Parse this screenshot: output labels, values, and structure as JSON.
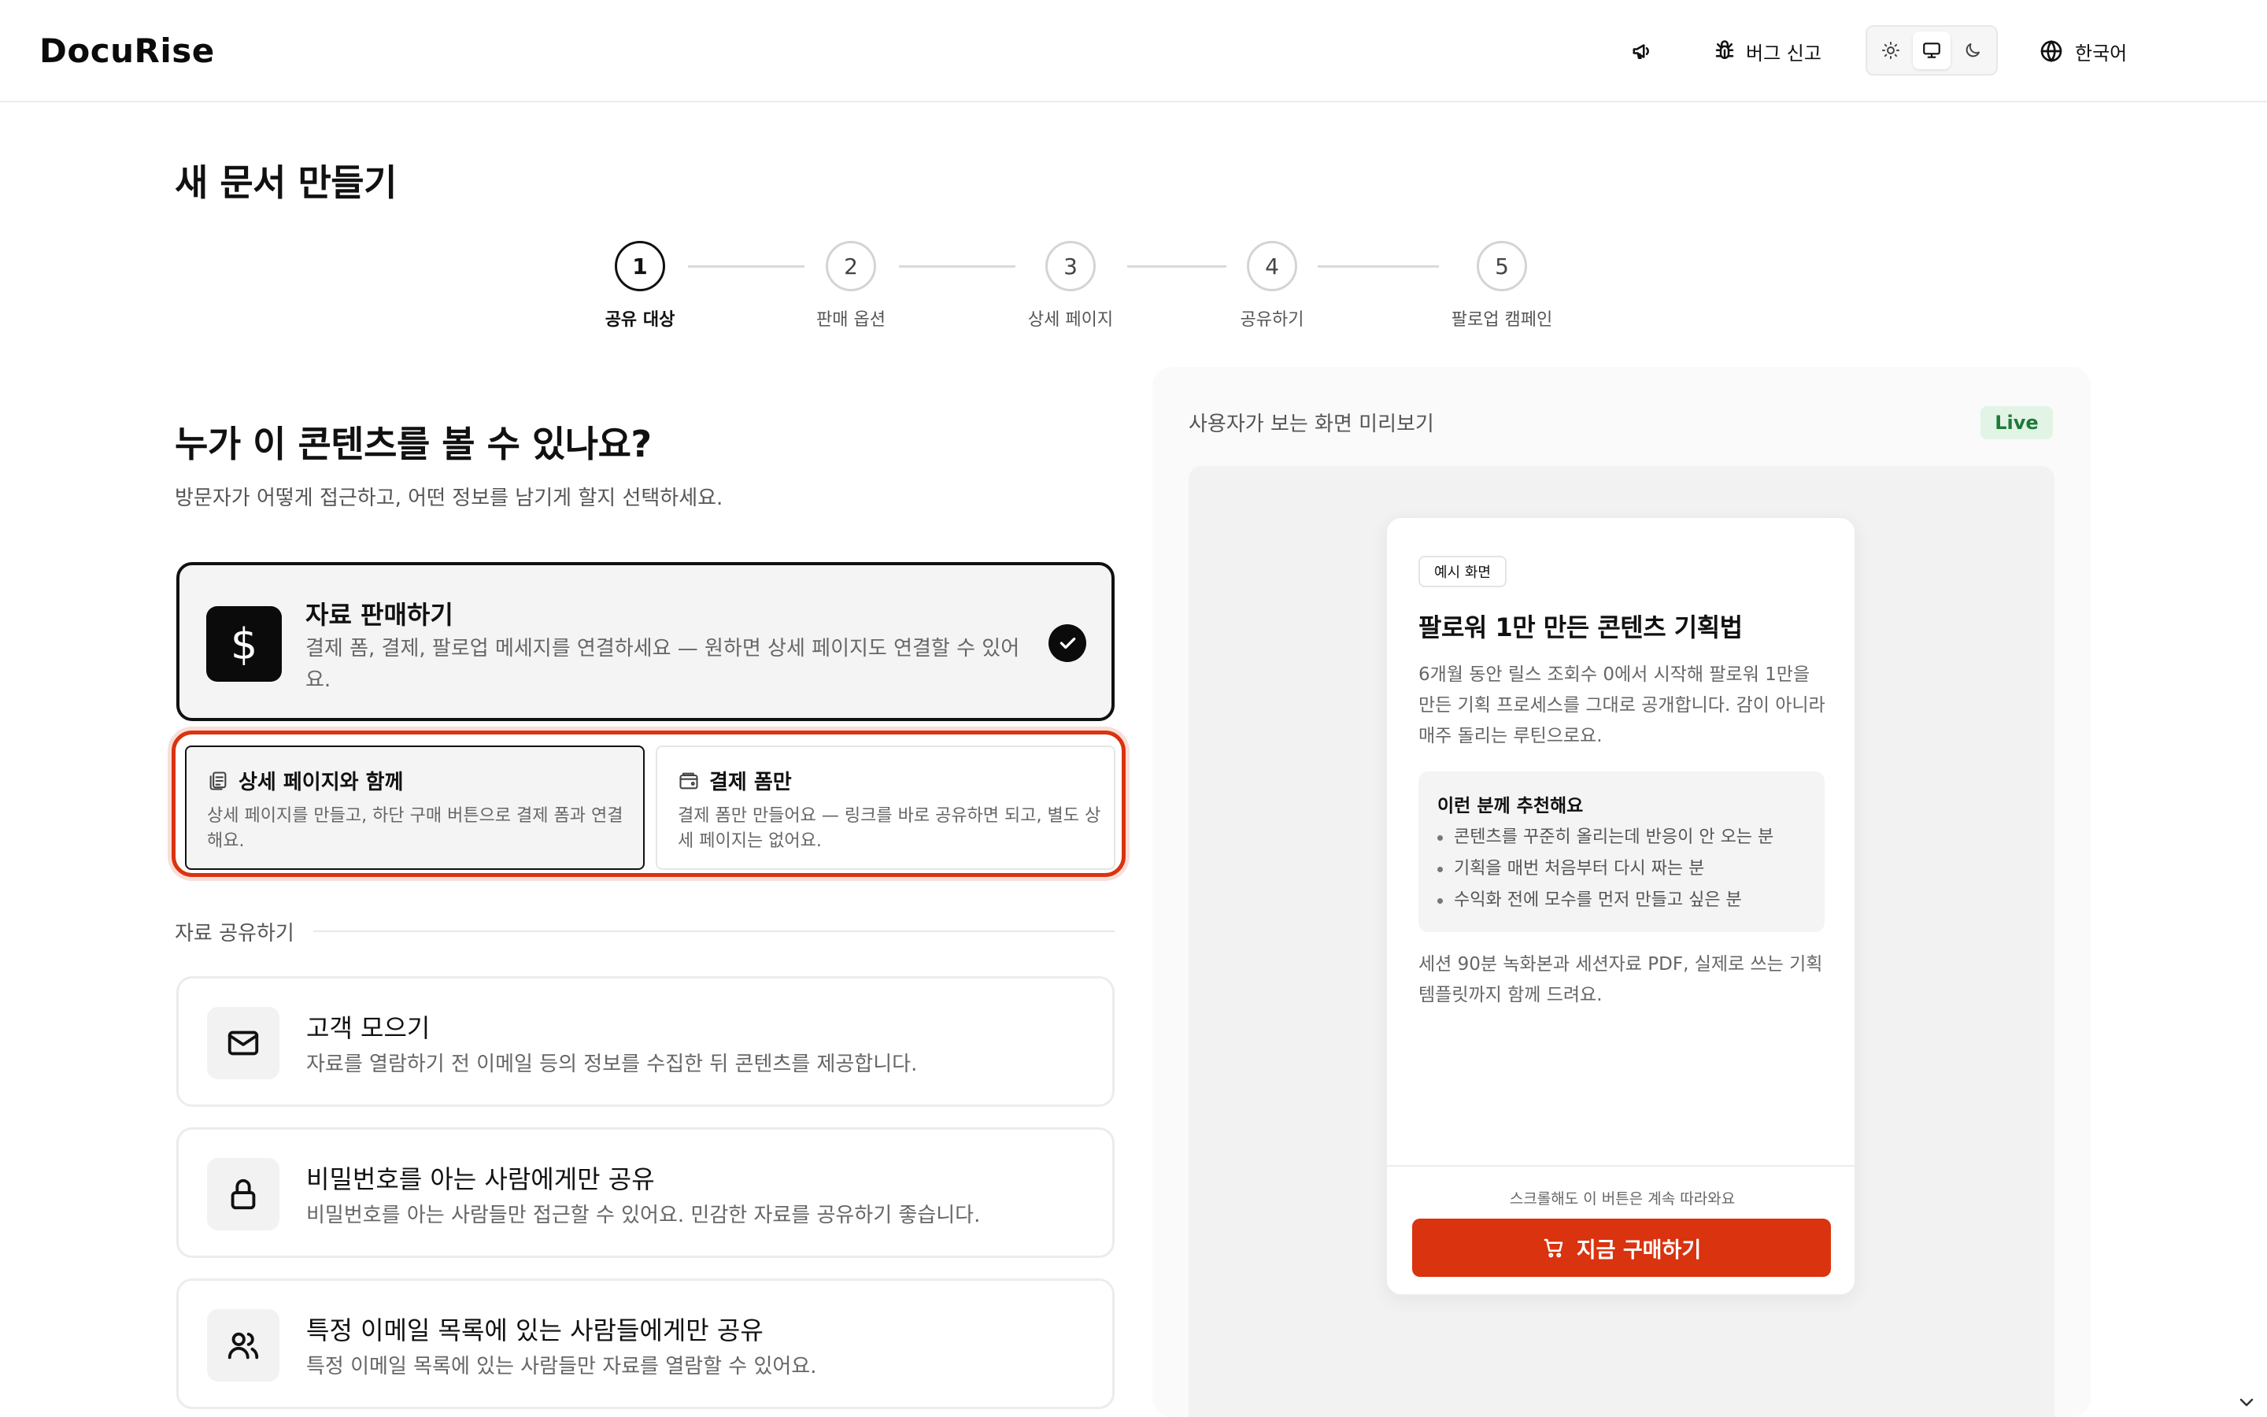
{
  "app": {
    "logo": "DocuRise"
  },
  "header": {
    "bug_report": "버그 신고",
    "language": "한국어",
    "theme_options": [
      "light",
      "system",
      "dark"
    ],
    "theme_active": "system"
  },
  "page": {
    "title": "새 문서 만들기"
  },
  "stepper": {
    "steps": [
      {
        "num": "1",
        "label": "공유 대상",
        "active": true
      },
      {
        "num": "2",
        "label": "판매 옵션",
        "active": false
      },
      {
        "num": "3",
        "label": "상세 페이지",
        "active": false
      },
      {
        "num": "4",
        "label": "공유하기",
        "active": false
      },
      {
        "num": "5",
        "label": "팔로업 캠페인",
        "active": false
      }
    ]
  },
  "question": {
    "title": "누가 이 콘텐츠를 볼 수 있나요?",
    "subtitle": "방문자가 어떻게 접근하고, 어떤 정보를 남기게 할지 선택하세요."
  },
  "sell": {
    "icon": "$",
    "title": "자료 판매하기",
    "desc": "결제 폼, 결제, 팔로업 메세지를 연결하세요 — 원하면 상세 페이지도 연결할 수 있어요.",
    "selected": true
  },
  "sell_options": [
    {
      "title": "상세 페이지와 함께",
      "desc": "상세 페이지를 만들고, 하단 구매 버튼으로 결제 폼과 연결해요.",
      "selected": true
    },
    {
      "title": "결제 폼만",
      "desc": "결제 폼만 만들어요 — 링크를 바로 공유하면 되고, 별도 상세 페이지는 없어요.",
      "selected": false
    }
  ],
  "share": {
    "section_label": "자료 공유하기",
    "items": [
      {
        "title": "고객 모으기",
        "desc": "자료를 열람하기 전 이메일 등의 정보를 수집한 뒤 콘텐츠를 제공합니다."
      },
      {
        "title": "비밀번호를 아는 사람에게만 공유",
        "desc": "비밀번호를 아는 사람들만 접근할 수 있어요. 민감한 자료를 공유하기 좋습니다."
      },
      {
        "title": "특정 이메일 목록에 있는 사람들에게만 공유",
        "desc": "특정 이메일 목록에 있는 사람들만 자료를 열람할 수 있어요."
      }
    ]
  },
  "preview": {
    "label": "사용자가 보는 화면 미리보기",
    "badge": "Live",
    "card": {
      "badge": "예시 화면",
      "title": "팔로워 1만 만든 콘텐츠 기획법",
      "desc": "6개월 동안 릴스 조회수 0에서 시작해 팔로워 1만을 만든 기획 프로세스를 그대로 공개합니다. 감이 아니라 매주 돌리는 루틴으로요.",
      "recommend_title": "이런 분께 추천해요",
      "recommend": [
        "콘텐츠를 꾸준히 올리는데 반응이 안 오는 분",
        "기획을 매번 처음부터 다시 짜는 분",
        "수익화 전에 모수를 먼저 만들고 싶은 분"
      ],
      "extra": "세션 90분 녹화본과 세션자료 PDF, 실제로 쓰는 기획 템플릿까지 함께 드려요.",
      "sticky_hint": "스크롤해도 이 버튼은 계속 따라와요",
      "buy_label": "지금 구매하기"
    }
  },
  "colors": {
    "accent": "#d9330f",
    "live_bg": "#e2f4e6",
    "live_fg": "#1e7a3a",
    "dark": "#0b0b0b"
  }
}
